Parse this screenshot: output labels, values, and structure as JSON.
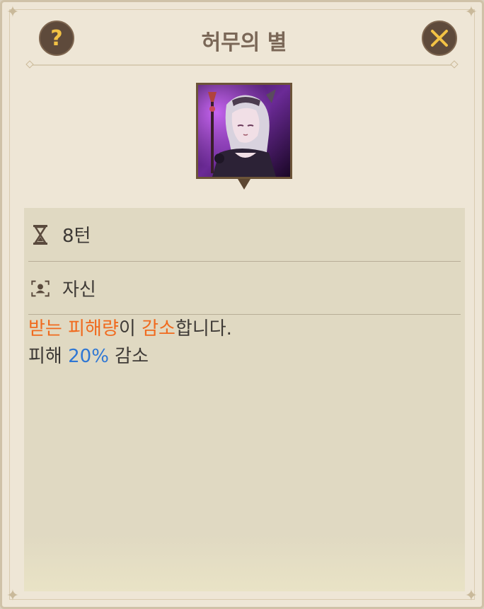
{
  "header": {
    "title": "허무의 별",
    "help_icon": "question-mark",
    "close_icon": "x-cross"
  },
  "effect": {
    "duration": {
      "icon": "hourglass-icon",
      "text": "8턴"
    },
    "target": {
      "icon": "target-self-icon",
      "text": "자신"
    },
    "description": {
      "line1": [
        {
          "text": "받는 피해량",
          "color": "#f06a1e"
        },
        {
          "text": "이 ",
          "color": "#3e3a36"
        },
        {
          "text": "감소",
          "color": "#f06a1e"
        },
        {
          "text": "합니다.",
          "color": "#3e3a36"
        }
      ],
      "line2": [
        {
          "text": "피해 ",
          "color": "#3e3a36"
        },
        {
          "text": "20%",
          "color": "#2f77d4"
        },
        {
          "text": " 감소",
          "color": "#3e3a36"
        }
      ]
    }
  },
  "colors": {
    "panel_bg": "#eee6d6",
    "content_bg": "#e0d9c2",
    "accent_orange": "#f06a1e",
    "accent_blue": "#2f77d4",
    "title": "#7a6757"
  }
}
